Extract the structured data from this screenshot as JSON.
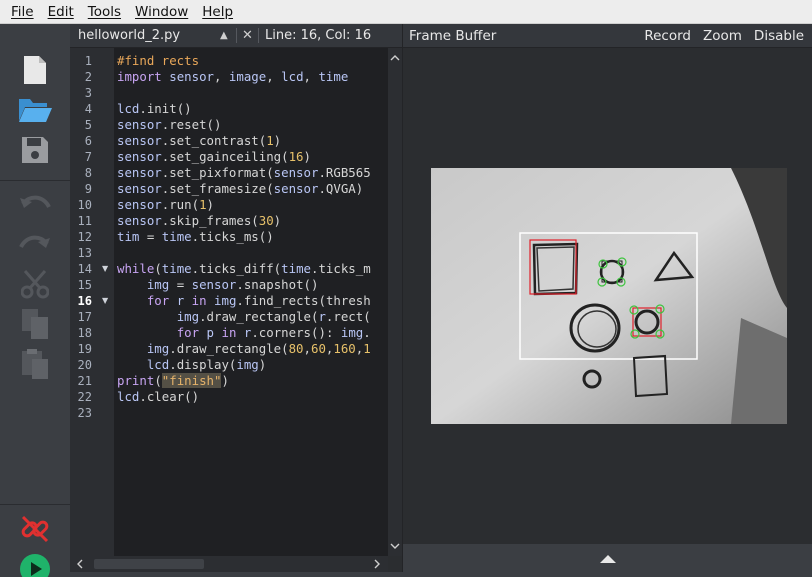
{
  "menu": [
    {
      "label": "File"
    },
    {
      "label": "Edit"
    },
    {
      "label": "Tools"
    },
    {
      "label": "Window"
    },
    {
      "label": "Help"
    }
  ],
  "toolbar": {
    "icons": [
      "new-file-icon",
      "open-folder-icon",
      "save-icon",
      "undo-icon",
      "redo-icon",
      "cut-icon",
      "copy-icon",
      "paste-icon",
      "disconnect-icon",
      "run-icon"
    ]
  },
  "editor": {
    "file_name": "helloworld_2.py",
    "cursor_position": "Line: 16, Col: 16",
    "current_line": 16,
    "line_numbers": [
      "1",
      "2",
      "3",
      "4",
      "5",
      "6",
      "7",
      "8",
      "9",
      "10",
      "11",
      "12",
      "13",
      "14",
      "15",
      "16",
      "17",
      "18",
      "19",
      "20",
      "21",
      "22",
      "23"
    ],
    "lines": [
      "#find rects",
      "import sensor, image, lcd, time",
      "",
      "lcd.init()",
      "sensor.reset()",
      "sensor.set_contrast(1)",
      "sensor.set_gainceiling(16)",
      "sensor.set_pixformat(sensor.RGB565",
      "sensor.set_framesize(sensor.QVGA)",
      "sensor.run(1)",
      "sensor.skip_frames(30)",
      "tim = time.ticks_ms()",
      "",
      "while(time.ticks_diff(time.ticks_m",
      "    img = sensor.snapshot()",
      "    for r in img.find_rects(thresh",
      "        img.draw_rectangle(r.rect(",
      "        for p in r.corners(): img.",
      "    img.draw_rectangle(80,60,160,1",
      "    lcd.display(img)",
      "print(\"finish\")",
      "lcd.clear()",
      ""
    ]
  },
  "frame_buffer": {
    "title": "Frame Buffer",
    "record_label": "Record",
    "zoom_label": "Zoom",
    "disable_label": "Disable"
  },
  "colors": {
    "keyword": "#c7a4f2",
    "comment": "#e8a75a",
    "function": "#b9c6f5",
    "number": "#e7c16a",
    "detected_rect": "#e0202a",
    "corner_marker": "#3ec43e"
  }
}
